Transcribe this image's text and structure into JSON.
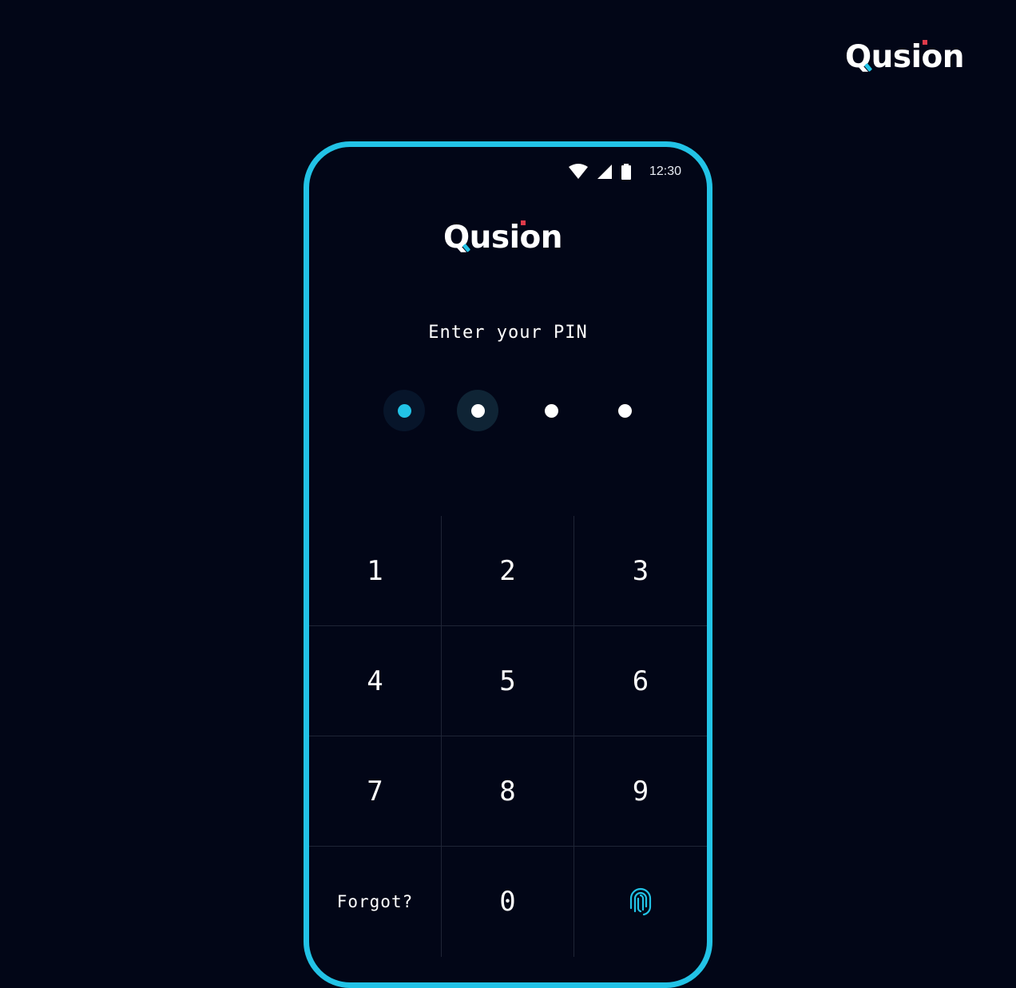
{
  "brand": {
    "name": "Qusion",
    "accent_red": "#e03a4a",
    "accent_cyan": "#22c3e6"
  },
  "status_bar": {
    "time": "12:30",
    "icons": [
      "wifi-icon",
      "cellular-signal-icon",
      "battery-icon"
    ]
  },
  "lock_screen": {
    "prompt": "Enter your PIN",
    "pin": {
      "length": 4,
      "entered": 1,
      "current_index": 1
    },
    "keys": [
      "1",
      "2",
      "3",
      "4",
      "5",
      "6",
      "7",
      "8",
      "9"
    ],
    "forgot_label": "Forgot?",
    "zero_key": "0",
    "biometric_icon": "fingerprint-icon"
  },
  "colors": {
    "background": "#020617",
    "frame": "#22c3e6",
    "divider": "#1f2536"
  }
}
